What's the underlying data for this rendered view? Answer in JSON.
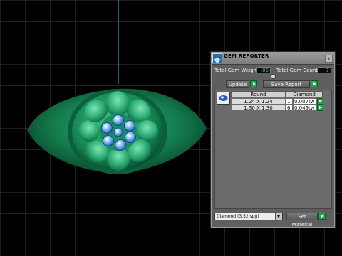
{
  "panel": {
    "title": "GEM REPORTER",
    "close_glyph": "x",
    "total_weight_label": "Total Gem Weight",
    "total_weight_value": ".06",
    "total_count_label": "Total Gem Count",
    "total_count_value": "7",
    "update_label": "Update",
    "save_report_label": "Save Report",
    "table": {
      "columns": [
        "Round",
        "Diamond"
      ],
      "rows": [
        {
          "size": "1.24 X 1.24",
          "qty": "1",
          "weight": "0.007tw"
        },
        {
          "size": "1.30 X 1.30",
          "qty": "6",
          "weight": "0.049tw"
        }
      ]
    },
    "material_select": "Diamond    (3.52 spg)",
    "set_material_label": "Set Material"
  },
  "colors": {
    "ring_green": "#1d8a5a",
    "gem_blue": "#4aa0f0",
    "grid_line": "#3a3a3a",
    "axis_line": "#33c6e6",
    "value_green": "#39d16a"
  }
}
